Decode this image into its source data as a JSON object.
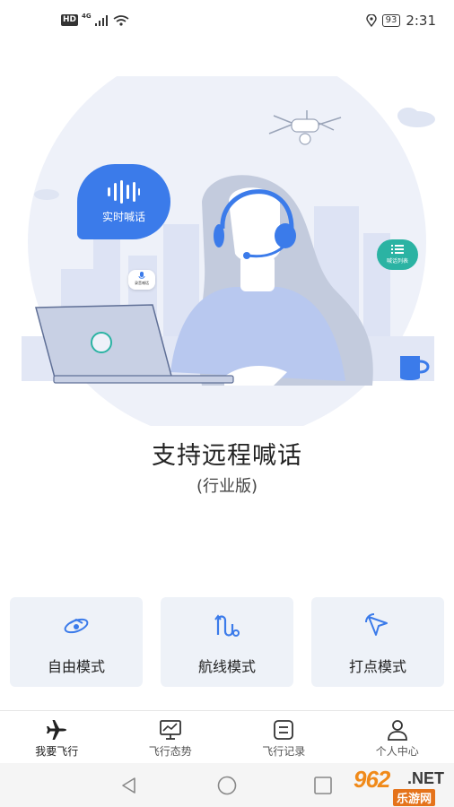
{
  "status_bar": {
    "hd_badge": "HD",
    "network": "4G",
    "battery": "93",
    "time": "2:31"
  },
  "hero": {
    "talk_bubble_label": "实时喊话",
    "list_bubble_label": "喊话列表",
    "record_bubble_label": "录音喊话"
  },
  "title": "支持远程喊话",
  "subtitle": "(行业版)",
  "modes": [
    {
      "label": "自由模式",
      "icon": "free-mode-icon"
    },
    {
      "label": "航线模式",
      "icon": "route-mode-icon"
    },
    {
      "label": "打点模式",
      "icon": "waypoint-mode-icon"
    }
  ],
  "bottom_nav": [
    {
      "label": "我要飞行",
      "icon": "airplane-icon",
      "active": true
    },
    {
      "label": "飞行态势",
      "icon": "monitor-icon",
      "active": false
    },
    {
      "label": "飞行记录",
      "icon": "record-icon",
      "active": false
    },
    {
      "label": "个人中心",
      "icon": "person-icon",
      "active": false
    }
  ],
  "watermark": {
    "number": "962",
    "net": ".NET",
    "site": "乐游网"
  },
  "colors": {
    "accent_blue": "#3b7bea",
    "teal": "#2bb3a3",
    "card_bg": "#eef2f8",
    "hero_circle": "#eef1f9"
  }
}
